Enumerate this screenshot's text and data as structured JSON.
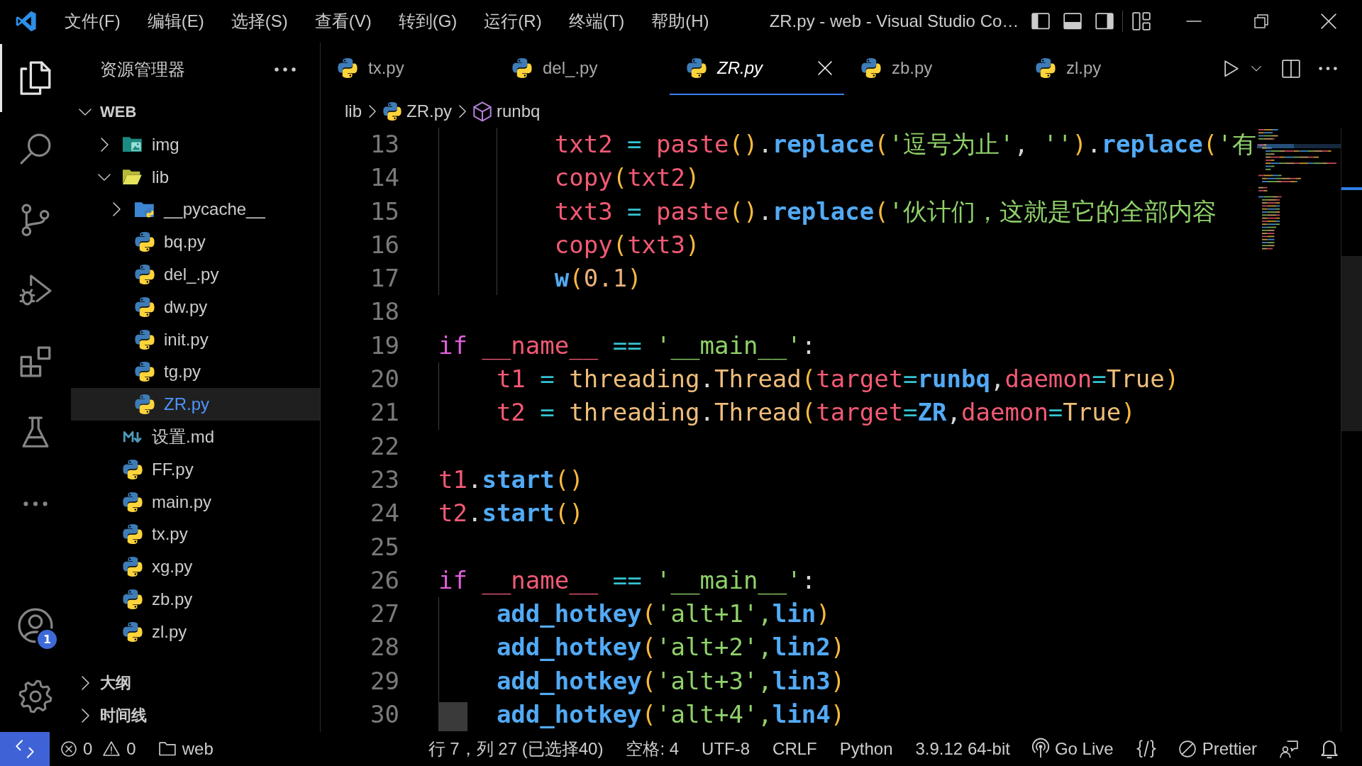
{
  "title_bar": {
    "menus": [
      "文件(F)",
      "编辑(E)",
      "选择(S)",
      "查看(V)",
      "转到(G)",
      "运行(R)",
      "终端(T)",
      "帮助(H)"
    ],
    "title": "ZR.py - web - Visual Studio Co…"
  },
  "activity_bar": {
    "items": [
      {
        "kind": "explorer",
        "selected": true
      },
      {
        "kind": "search",
        "selected": false
      },
      {
        "kind": "scm",
        "selected": false
      },
      {
        "kind": "debug",
        "selected": false
      },
      {
        "kind": "extensions",
        "selected": false
      },
      {
        "kind": "testing",
        "selected": false
      },
      {
        "kind": "more",
        "selected": false
      }
    ],
    "bottom_items": [
      {
        "kind": "accounts",
        "badge": "1"
      },
      {
        "kind": "manage"
      }
    ]
  },
  "sidebar": {
    "title": "资源管理器",
    "sections": [
      {
        "label": "WEB",
        "expanded": true,
        "tree": [
          {
            "label": "img",
            "kind": "imgdir",
            "expanded": false,
            "selected": false
          },
          {
            "label": "lib",
            "kind": "libdir",
            "expanded": true,
            "selected": false,
            "children": [
              {
                "label": "__pycache__",
                "kind": "pydir",
                "expanded": false,
                "selected": false
              },
              {
                "label": "bq.py",
                "kind": "py",
                "selected": false
              },
              {
                "label": "del_.py",
                "kind": "py",
                "selected": false
              },
              {
                "label": "dw.py",
                "kind": "py",
                "selected": false
              },
              {
                "label": "init.py",
                "kind": "py",
                "selected": false
              },
              {
                "label": "tg.py",
                "kind": "py",
                "selected": false
              },
              {
                "label": "ZR.py",
                "kind": "py",
                "selected": true
              }
            ]
          },
          {
            "label": "设置.md",
            "kind": "md",
            "selected": false
          },
          {
            "label": "FF.py",
            "kind": "py",
            "selected": false
          },
          {
            "label": "main.py",
            "kind": "py",
            "selected": false
          },
          {
            "label": "tx.py",
            "kind": "py",
            "selected": false
          },
          {
            "label": "xg.py",
            "kind": "py",
            "selected": false
          },
          {
            "label": "zb.py",
            "kind": "py",
            "selected": false
          },
          {
            "label": "zl.py",
            "kind": "py",
            "selected": false
          }
        ]
      },
      {
        "label": "大纲",
        "expanded": false
      },
      {
        "label": "时间线",
        "expanded": false
      }
    ]
  },
  "editor": {
    "tabs": [
      {
        "label": "tx.py",
        "kind": "py",
        "selected": false,
        "preview": false
      },
      {
        "label": "del_.py",
        "kind": "py",
        "selected": false,
        "preview": false
      },
      {
        "label": "ZR.py",
        "kind": "py",
        "selected": true,
        "preview": true
      },
      {
        "label": "zb.py",
        "kind": "py",
        "selected": false,
        "preview": false
      },
      {
        "label": "zl.py",
        "kind": "py",
        "selected": false,
        "preview": false
      }
    ],
    "breadcrumb": [
      {
        "kind": "folder",
        "label": "lib"
      },
      {
        "kind": "py",
        "label": "ZR.py"
      },
      {
        "kind": "symbol",
        "label": "runbq"
      }
    ],
    "lines": [
      {
        "number": "13",
        "highlight": false,
        "tokens": [
          {
            "kind": "var",
            "text": "        txt2"
          },
          {
            "kind": "op",
            "text": " = "
          },
          {
            "kind": "var",
            "text": "paste"
          },
          {
            "kind": "paren",
            "text": "()"
          },
          {
            "kind": "punct",
            "text": "."
          },
          {
            "kind": "func",
            "text": "replace"
          },
          {
            "kind": "paren",
            "text": "("
          },
          {
            "kind": "str",
            "text": "'逗号为止'"
          },
          {
            "kind": "punct",
            "text": ", "
          },
          {
            "kind": "str",
            "text": "''"
          },
          {
            "kind": "paren",
            "text": ")"
          },
          {
            "kind": "punct",
            "text": "."
          },
          {
            "kind": "func",
            "text": "replace"
          },
          {
            "kind": "paren",
            "text": "("
          },
          {
            "kind": "str",
            "text": "'有"
          }
        ]
      },
      {
        "number": "14",
        "highlight": false,
        "tokens": [
          {
            "kind": "var",
            "text": "        copy"
          },
          {
            "kind": "paren",
            "text": "("
          },
          {
            "kind": "var",
            "text": "txt2"
          },
          {
            "kind": "paren",
            "text": ")"
          }
        ]
      },
      {
        "number": "15",
        "highlight": false,
        "tokens": [
          {
            "kind": "var",
            "text": "        txt3"
          },
          {
            "kind": "op",
            "text": " = "
          },
          {
            "kind": "var",
            "text": "paste"
          },
          {
            "kind": "paren",
            "text": "()"
          },
          {
            "kind": "punct",
            "text": "."
          },
          {
            "kind": "func",
            "text": "replace"
          },
          {
            "kind": "paren",
            "text": "("
          },
          {
            "kind": "str",
            "text": "'伙计们，这就是它的全部内容"
          }
        ]
      },
      {
        "number": "16",
        "highlight": false,
        "tokens": [
          {
            "kind": "var",
            "text": "        copy"
          },
          {
            "kind": "paren",
            "text": "("
          },
          {
            "kind": "var",
            "text": "txt3"
          },
          {
            "kind": "paren",
            "text": ")"
          }
        ]
      },
      {
        "number": "17",
        "highlight": false,
        "tokens": [
          {
            "kind": "func",
            "text": "        w"
          },
          {
            "kind": "paren",
            "text": "("
          },
          {
            "kind": "num",
            "text": "0.1"
          },
          {
            "kind": "paren",
            "text": ")"
          }
        ]
      },
      {
        "number": "18",
        "highlight": false
      },
      {
        "number": "19",
        "highlight": false,
        "tokens": [
          {
            "kind": "kw",
            "text": "if"
          },
          {
            "kind": "var",
            "text": " __name__"
          },
          {
            "kind": "op",
            "text": " == "
          },
          {
            "kind": "str",
            "text": "'__main__'"
          },
          {
            "kind": "punct",
            "text": ":"
          }
        ]
      },
      {
        "number": "20",
        "highlight": false,
        "tokens": [
          {
            "kind": "var",
            "text": "    t1"
          },
          {
            "kind": "op",
            "text": " = "
          },
          {
            "kind": "cls",
            "text": "threading"
          },
          {
            "kind": "punct",
            "text": "."
          },
          {
            "kind": "cls",
            "text": "Thread"
          },
          {
            "kind": "paren",
            "text": "("
          },
          {
            "kind": "var",
            "text": "target"
          },
          {
            "kind": "op",
            "text": "="
          },
          {
            "kind": "func",
            "text": "runbq"
          },
          {
            "kind": "punct",
            "text": ","
          },
          {
            "kind": "var",
            "text": "daemon"
          },
          {
            "kind": "op",
            "text": "="
          },
          {
            "kind": "cls",
            "text": "True"
          },
          {
            "kind": "paren",
            "text": ")"
          }
        ]
      },
      {
        "number": "21",
        "highlight": false,
        "tokens": [
          {
            "kind": "var",
            "text": "    t2"
          },
          {
            "kind": "op",
            "text": " = "
          },
          {
            "kind": "cls",
            "text": "threading"
          },
          {
            "kind": "punct",
            "text": "."
          },
          {
            "kind": "cls",
            "text": "Thread"
          },
          {
            "kind": "paren",
            "text": "("
          },
          {
            "kind": "var",
            "text": "target"
          },
          {
            "kind": "op",
            "text": "="
          },
          {
            "kind": "func",
            "text": "ZR"
          },
          {
            "kind": "punct",
            "text": ","
          },
          {
            "kind": "var",
            "text": "daemon"
          },
          {
            "kind": "op",
            "text": "="
          },
          {
            "kind": "cls",
            "text": "True"
          },
          {
            "kind": "paren",
            "text": ")"
          }
        ]
      },
      {
        "number": "22",
        "highlight": false
      },
      {
        "number": "23",
        "highlight": false,
        "tokens": [
          {
            "kind": "var",
            "text": "t1"
          },
          {
            "kind": "punct",
            "text": "."
          },
          {
            "kind": "func",
            "text": "start"
          },
          {
            "kind": "paren",
            "text": "()"
          }
        ]
      },
      {
        "number": "24",
        "highlight": false,
        "tokens": [
          {
            "kind": "var",
            "text": "t2"
          },
          {
            "kind": "punct",
            "text": "."
          },
          {
            "kind": "func",
            "text": "start"
          },
          {
            "kind": "paren",
            "text": "()"
          }
        ]
      },
      {
        "number": "25",
        "highlight": false
      },
      {
        "number": "26",
        "highlight": false,
        "tokens": [
          {
            "kind": "kw",
            "text": "if"
          },
          {
            "kind": "var",
            "text": " __name__"
          },
          {
            "kind": "op",
            "text": " == "
          },
          {
            "kind": "str",
            "text": "'__main__'"
          },
          {
            "kind": "punct",
            "text": ":"
          }
        ]
      },
      {
        "number": "27",
        "highlight": false,
        "tokens": [
          {
            "kind": "func",
            "text": "    add_hotkey"
          },
          {
            "kind": "paren",
            "text": "("
          },
          {
            "kind": "str",
            "text": "'alt+1',"
          },
          {
            "kind": "func",
            "text": "lin"
          },
          {
            "kind": "paren",
            "text": ")"
          }
        ]
      },
      {
        "number": "28",
        "highlight": false,
        "tokens": [
          {
            "kind": "func",
            "text": "    add_hotkey"
          },
          {
            "kind": "paren",
            "text": "("
          },
          {
            "kind": "str",
            "text": "'alt+2',"
          },
          {
            "kind": "func",
            "text": "lin2"
          },
          {
            "kind": "paren",
            "text": ")"
          }
        ]
      },
      {
        "number": "29",
        "highlight": false,
        "tokens": [
          {
            "kind": "func",
            "text": "    add_hotkey"
          },
          {
            "kind": "paren",
            "text": "("
          },
          {
            "kind": "str",
            "text": "'alt+3',"
          },
          {
            "kind": "func",
            "text": "lin3"
          },
          {
            "kind": "paren",
            "text": ")"
          }
        ]
      },
      {
        "number": "30",
        "highlight": true,
        "tokens": [
          {
            "kind": "func",
            "text": "    add_hotkey"
          },
          {
            "kind": "paren",
            "text": "("
          },
          {
            "kind": "str",
            "text": "'alt+4',"
          },
          {
            "kind": "func",
            "text": "lin4"
          },
          {
            "kind": "paren",
            "text": ")"
          }
        ]
      }
    ]
  },
  "status_bar": {
    "left": [
      {
        "kind": "remote"
      },
      {
        "kind": "problems",
        "errors": "0",
        "warnings": "0"
      },
      {
        "kind": "folder",
        "text": "web"
      }
    ],
    "right": [
      {
        "kind": "text",
        "text": "行 7，列 27 (已选择40)"
      },
      {
        "kind": "text",
        "text": "空格: 4"
      },
      {
        "kind": "text",
        "text": "UTF-8"
      },
      {
        "kind": "text",
        "text": "CRLF"
      },
      {
        "kind": "text",
        "text": "Python"
      },
      {
        "kind": "text",
        "text": "3.9.12 64-bit"
      },
      {
        "kind": "golive",
        "text": "Go Live"
      },
      {
        "kind": "braces"
      },
      {
        "kind": "prettier",
        "text": "Prettier"
      },
      {
        "kind": "feedback"
      },
      {
        "kind": "bell"
      }
    ]
  }
}
